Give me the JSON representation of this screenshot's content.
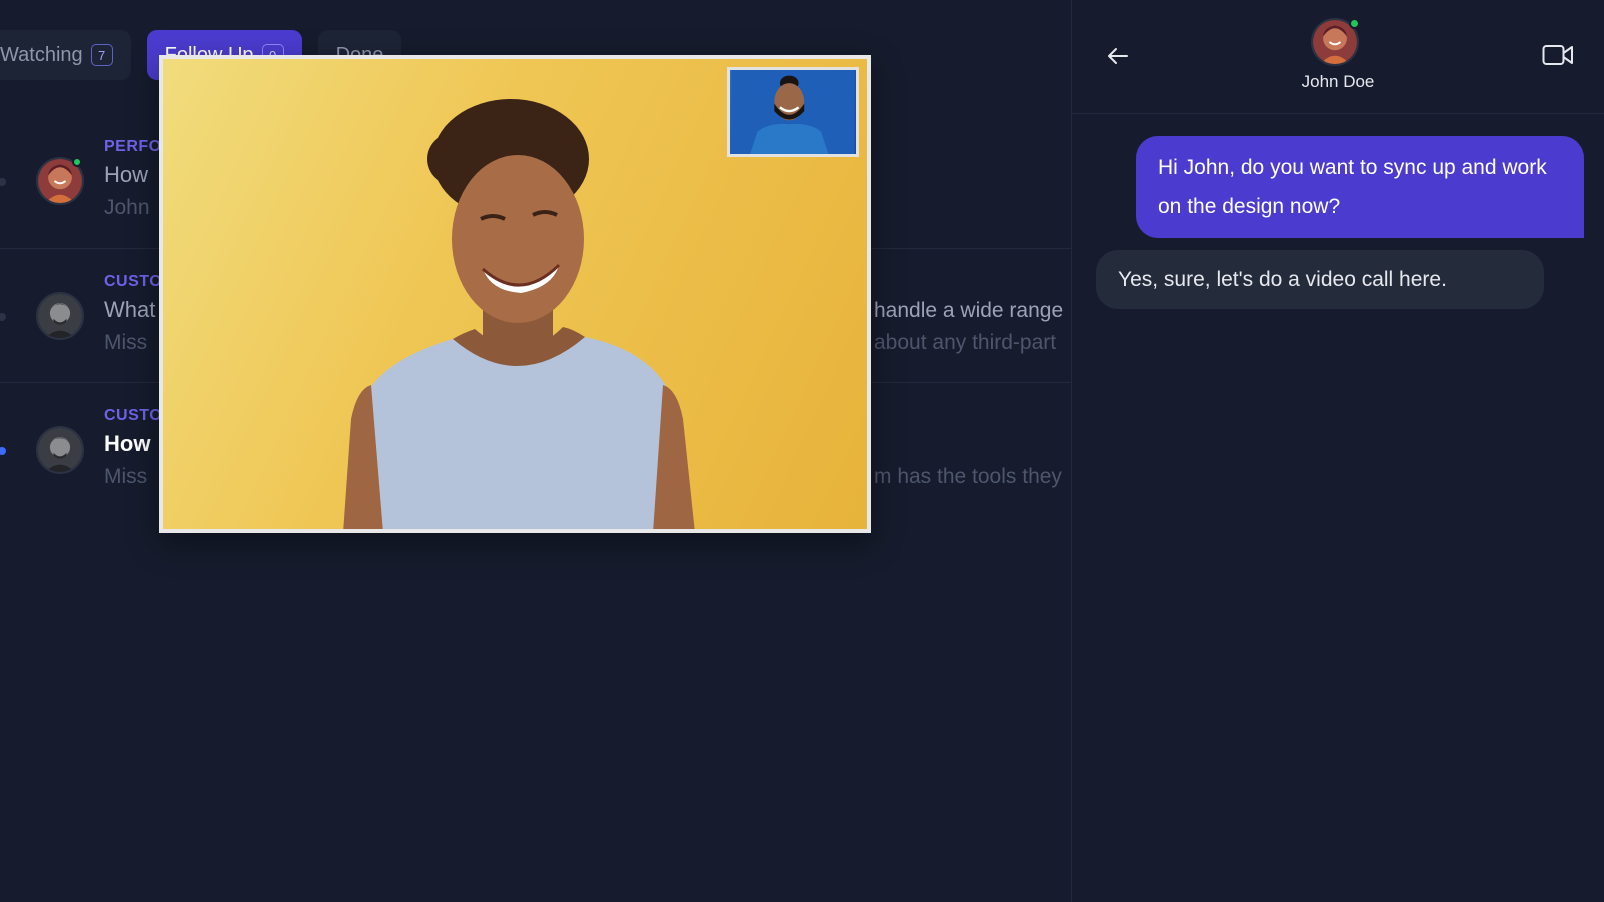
{
  "tabs": [
    {
      "label": "Watching",
      "count": "7",
      "active": false
    },
    {
      "label": "Follow Up",
      "count": "0",
      "active": true
    },
    {
      "label": "Done",
      "count": "",
      "active": false
    }
  ],
  "tickets": [
    {
      "category": "PERFO",
      "subject": "How",
      "preview": "John",
      "tail_top": "",
      "tail_bottom": "",
      "unread": false,
      "online": true
    },
    {
      "category": "CUSTO",
      "subject": "What",
      "preview": "Miss",
      "tail_top": "handle a wide range",
      "tail_bottom": "about any third-part",
      "unread": false,
      "online": false
    },
    {
      "category": "CUSTO",
      "subject": "How",
      "preview": "Miss",
      "tail_top": "",
      "tail_bottom": "m has the tools they",
      "unread": true,
      "online": false
    }
  ],
  "chat": {
    "contact_name": "John Doe",
    "messages": [
      {
        "direction": "out",
        "text": "Hi John, do you want to sync up and work on the design now?"
      },
      {
        "direction": "in",
        "text": "Yes, sure, let's do a video call here."
      }
    ]
  },
  "colors": {
    "background": "#161c2d",
    "accent": "#4b3ccf",
    "online": "#22c55e",
    "unread": "#3d6bff",
    "category": "#6d63e8"
  },
  "icons": {
    "back": "arrow-left-icon",
    "video": "video-camera-icon"
  }
}
